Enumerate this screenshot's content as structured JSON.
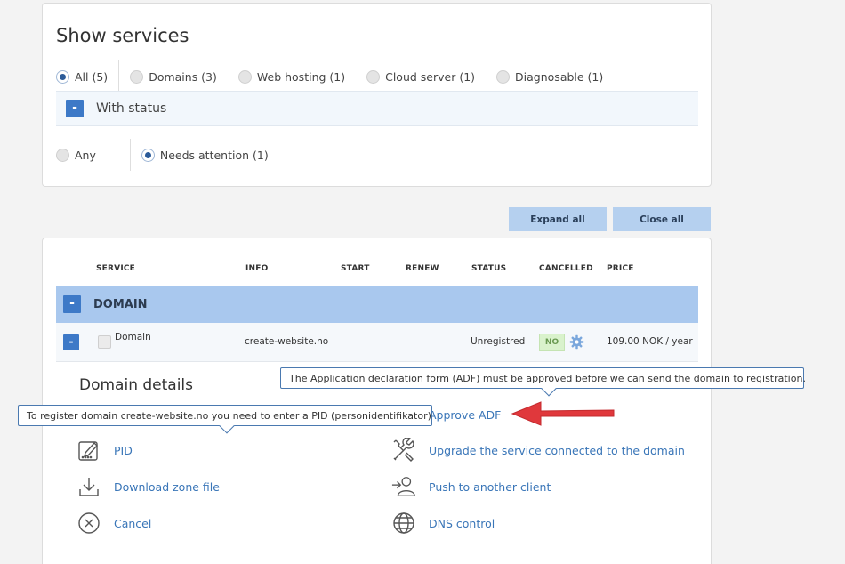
{
  "filter": {
    "title": "Show services",
    "categories": [
      {
        "label": "All (5)",
        "checked": true
      },
      {
        "label": "Domains (3)",
        "checked": false
      },
      {
        "label": "Web hosting (1)",
        "checked": false
      },
      {
        "label": "Cloud server (1)",
        "checked": false
      },
      {
        "label": "Diagnosable (1)",
        "checked": false
      }
    ],
    "status_toggle": "-",
    "status_label": "With status",
    "statuses": [
      {
        "label": "Any",
        "checked": false
      },
      {
        "label": "Needs attention (1)",
        "checked": true
      }
    ]
  },
  "buttons": {
    "expand_all": "Expand all",
    "close_all": "Close all"
  },
  "table": {
    "headers": {
      "service": "SERVICE",
      "info": "INFO",
      "start": "START",
      "renew": "RENEW",
      "status": "STATUS",
      "cancelled": "CANCELLED",
      "price": "PRICE"
    },
    "group": {
      "toggle": "-",
      "label": "DOMAIN"
    },
    "rows": [
      {
        "toggle": "-",
        "service": "Domain",
        "info": "create-website.no",
        "start": "",
        "renew": "",
        "status": "Unregistred",
        "cancelled": "NO",
        "price": "109.00 NOK / year"
      }
    ]
  },
  "details": {
    "title": "Domain details",
    "left_actions": [
      {
        "label": "PID",
        "icon": "pid-card-icon"
      },
      {
        "label": "Download zone file",
        "icon": "download-icon"
      },
      {
        "label": "Cancel",
        "icon": "cancel-circle-icon"
      }
    ],
    "right_actions": [
      {
        "label": "Approve ADF",
        "icon": "approve-icon"
      },
      {
        "label": "Upgrade the service connected to the domain",
        "icon": "tools-icon"
      },
      {
        "label": "Push to another client",
        "icon": "push-client-icon"
      },
      {
        "label": "DNS control",
        "icon": "globe-icon"
      }
    ]
  },
  "tooltips": {
    "adf": "The Application declaration form (ADF) must be approved before we can send the domain to registration.",
    "pid": "To register domain create-website.no you need to enter a PID (personidentifikator)"
  },
  "colors": {
    "accent": "#3d79c7",
    "header_bar": "#a9c8ee",
    "link": "#3a76b8",
    "arrow": "#e0383c",
    "badge_bg": "#d9f2cc"
  }
}
